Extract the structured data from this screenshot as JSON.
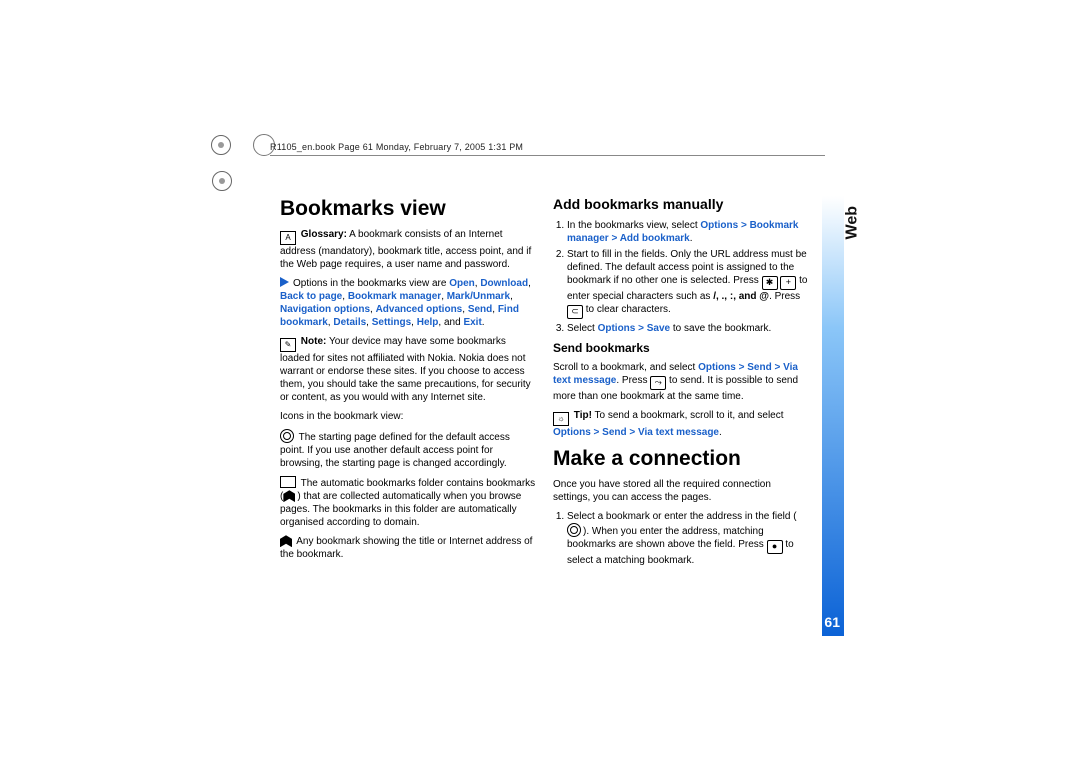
{
  "header": "R1105_en.book  Page 61  Monday, February 7, 2005  1:31 PM",
  "side_label": "Web",
  "page_number": "61",
  "h1_bookmarks": "Bookmarks view",
  "glossary": {
    "lead": "Glossary:",
    "text": " A bookmark consists of an Internet address (mandatory), bookmark title, access point, and if the Web page requires, a user name and password."
  },
  "options_intro": "Options in the bookmarks view are ",
  "options_list": [
    "Open",
    "Download",
    "Back to page",
    "Bookmark manager",
    "Mark/Unmark",
    "Navigation options",
    "Advanced options",
    "Send",
    "Find bookmark",
    "Details",
    "Settings",
    "Help"
  ],
  "options_tail": ", and ",
  "options_exit": "Exit",
  "note": {
    "lead": "Note:",
    "text": " Your device may have some bookmarks loaded for sites not affiliated with Nokia. Nokia does not warrant or endorse these sites. If you choose to access them, you should take the same precautions, for security or content, as you would with any Internet site."
  },
  "icons_intro": "Icons in the bookmark view:",
  "icon1": " The starting page defined for the default access point. If you use another default access point for browsing, the starting page is changed accordingly.",
  "icon2a": " The automatic bookmarks folder contains bookmarks (",
  "icon2b": ") that are collected automatically when you browse pages. The bookmarks in this folder are automatically organised according to domain.",
  "icon3": " Any bookmark showing the title or Internet address of the bookmark.",
  "h2_add": "Add bookmarks manually",
  "add_steps": {
    "s1a": "In the bookmarks view, select ",
    "s1b": "Options > Bookmark manager > Add bookmark",
    "s2a": "Start to fill in the fields. Only the URL address must be defined. The default access point is assigned to the bookmark if no other one is selected. Press ",
    "s2b": " to enter special characters such as ",
    "s2chars": "/, ., :, and @",
    "s2c": ". Press ",
    "s2d": " to clear characters.",
    "s3a": "Select ",
    "s3b": "Options > Save",
    "s3c": " to save the bookmark."
  },
  "h3_send": "Send bookmarks",
  "send_a": "Scroll to a bookmark, and select ",
  "send_b": "Options > Send > Via text message",
  "send_c": ". Press ",
  "send_d": " to send. It is possible to send more than one bookmark at the same time.",
  "tip": {
    "lead": "Tip!",
    "a": " To send a bookmark, scroll to it, and select ",
    "b": "Options > Send > Via text message"
  },
  "h1_conn": "Make a connection",
  "conn_intro": "Once you have stored all the required connection settings, you can access the pages.",
  "conn_step": {
    "a": "Select a bookmark or enter the address in the field (",
    "b": "). When you enter the address, matching bookmarks are shown above the field. Press ",
    "c": " to select a matching bookmark."
  }
}
